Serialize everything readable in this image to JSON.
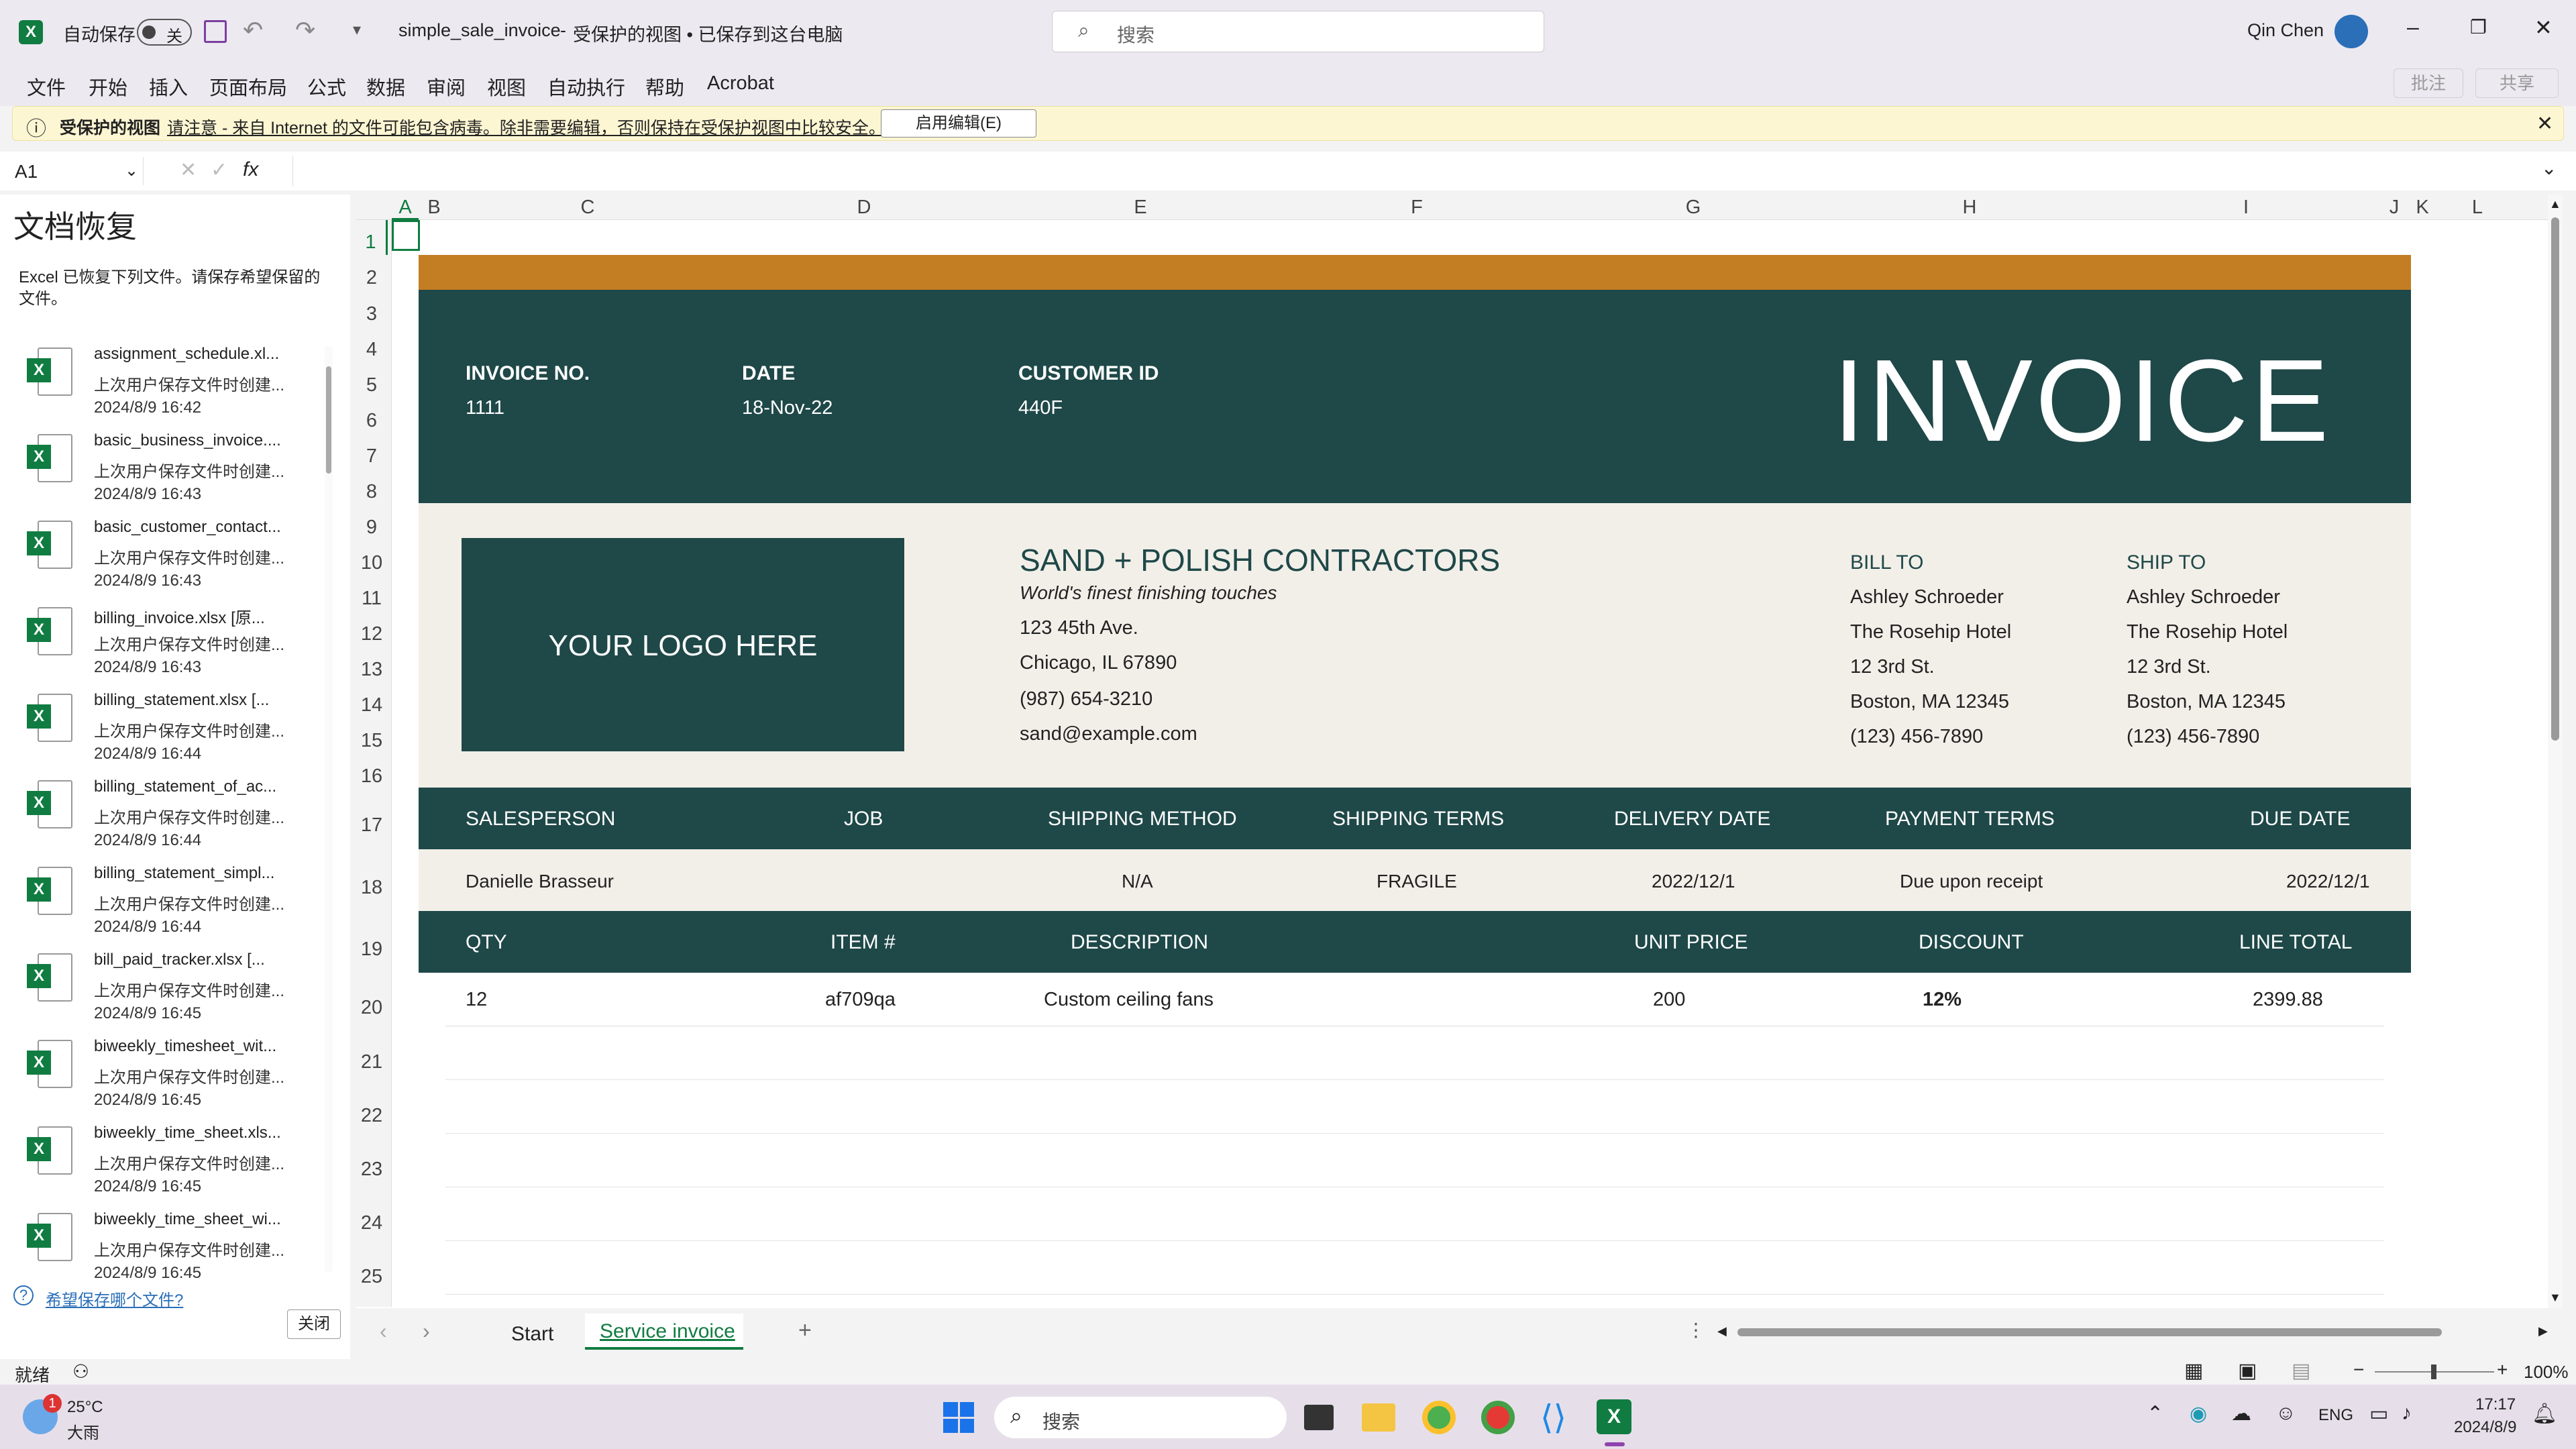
{
  "titlebar": {
    "autosave_label": "自动保存",
    "autosave_state": "关",
    "filename": "simple_sale_invoice",
    "status": "受保护的视图 • 已保存到这台电脑",
    "search_placeholder": "搜索",
    "user": "Qin Chen"
  },
  "menu": {
    "items": [
      "文件",
      "开始",
      "插入",
      "页面布局",
      "公式",
      "数据",
      "审阅",
      "视图",
      "自动执行",
      "帮助",
      "Acrobat"
    ],
    "comments": "批注",
    "share": "共享"
  },
  "msgbar": {
    "title": "受保护的视图",
    "text": "请注意 - 来自 Internet 的文件可能包含病毒。除非需要编辑，否则保持在受保护视图中比较安全。",
    "button": "启用编辑(E)"
  },
  "formula": {
    "namebox": "A1",
    "fx": "fx",
    "value": ""
  },
  "recovery": {
    "title": "文档恢复",
    "desc": "Excel 已恢复下列文件。请保存希望保留的文件。",
    "link": "希望保存哪个文件?",
    "close": "关闭",
    "files": [
      {
        "name": "assignment_schedule.xl...",
        "desc": "上次用户保存文件时创建...",
        "time": "2024/8/9 16:42"
      },
      {
        "name": "basic_business_invoice....",
        "desc": "上次用户保存文件时创建...",
        "time": "2024/8/9 16:43"
      },
      {
        "name": "basic_customer_contact...",
        "desc": "上次用户保存文件时创建...",
        "time": "2024/8/9 16:43"
      },
      {
        "name": "billing_invoice.xlsx [原...",
        "desc": "上次用户保存文件时创建...",
        "time": "2024/8/9 16:43"
      },
      {
        "name": "billing_statement.xlsx [...",
        "desc": "上次用户保存文件时创建...",
        "time": "2024/8/9 16:44"
      },
      {
        "name": "billing_statement_of_ac...",
        "desc": "上次用户保存文件时创建...",
        "time": "2024/8/9 16:44"
      },
      {
        "name": "billing_statement_simpl...",
        "desc": "上次用户保存文件时创建...",
        "time": "2024/8/9 16:44"
      },
      {
        "name": "bill_paid_tracker.xlsx [...",
        "desc": "上次用户保存文件时创建...",
        "time": "2024/8/9 16:45"
      },
      {
        "name": "biweekly_timesheet_wit...",
        "desc": "上次用户保存文件时创建...",
        "time": "2024/8/9 16:45"
      },
      {
        "name": "biweekly_time_sheet.xls...",
        "desc": "上次用户保存文件时创建...",
        "time": "2024/8/9 16:45"
      },
      {
        "name": "biweekly_time_sheet_wi...",
        "desc": "上次用户保存文件时创建...",
        "time": "2024/8/9 16:45"
      }
    ]
  },
  "columns": [
    "A",
    "B",
    "C",
    "D",
    "E",
    "F",
    "G",
    "H",
    "I",
    "J",
    "K",
    "L"
  ],
  "rows": [
    "1",
    "2",
    "3",
    "4",
    "5",
    "6",
    "7",
    "8",
    "9",
    "10",
    "11",
    "12",
    "13",
    "14",
    "15",
    "16",
    "17",
    "18",
    "19",
    "20",
    "21",
    "22",
    "23",
    "24",
    "25"
  ],
  "invoice": {
    "title": "INVOICE",
    "invoice_no_label": "INVOICE NO.",
    "invoice_no": "1111",
    "date_label": "DATE",
    "date": "18-Nov-22",
    "customer_id_label": "CUSTOMER ID",
    "customer_id": "440F",
    "logo": "YOUR LOGO HERE",
    "company": "SAND + POLISH CONTRACTORS",
    "tagline": "World's finest finishing touches",
    "address1": "123 45th Ave.",
    "address2": "Chicago, IL 67890",
    "phone": "(987) 654-3210",
    "email": "sand@example.com",
    "bill_to_label": "BILL TO",
    "ship_to_label": "SHIP TO",
    "bill_to": [
      "Ashley Schroeder",
      "The Rosehip Hotel",
      "12 3rd St.",
      "Boston, MA 12345",
      "(123) 456-7890"
    ],
    "ship_to": [
      "Ashley Schroeder",
      "The Rosehip Hotel",
      "12 3rd St.",
      "Boston, MA 12345",
      "(123) 456-7890"
    ],
    "info_headers": [
      "SALESPERSON",
      "JOB",
      "SHIPPING METHOD",
      "SHIPPING TERMS",
      "DELIVERY DATE",
      "PAYMENT TERMS",
      "DUE DATE"
    ],
    "info_values": [
      "Danielle Brasseur",
      "",
      "N/A",
      "FRAGILE",
      "2022/12/1",
      "Due upon receipt",
      "2022/12/1"
    ],
    "item_headers": [
      "QTY",
      "ITEM #",
      "DESCRIPTION",
      "UNIT PRICE",
      "DISCOUNT",
      "LINE TOTAL"
    ],
    "items": [
      {
        "qty": "12",
        "item": "af709qa",
        "desc": "Custom ceiling fans",
        "price": "200",
        "discount": "12%",
        "total": "2399.88"
      }
    ]
  },
  "sheets": {
    "tab1": "Start",
    "tab2": "Service invoice"
  },
  "status": {
    "ready": "就绪",
    "zoom": "100%"
  },
  "taskbar": {
    "temp": "25°C",
    "weather": "大雨",
    "search": "搜索",
    "lang": "ENG",
    "time": "17:17",
    "date": "2024/8/9"
  },
  "colors": {
    "dark": "#1f4848",
    "accent": "#c37d23",
    "cream": "#f2efe9",
    "excel_green": "#107c41"
  }
}
